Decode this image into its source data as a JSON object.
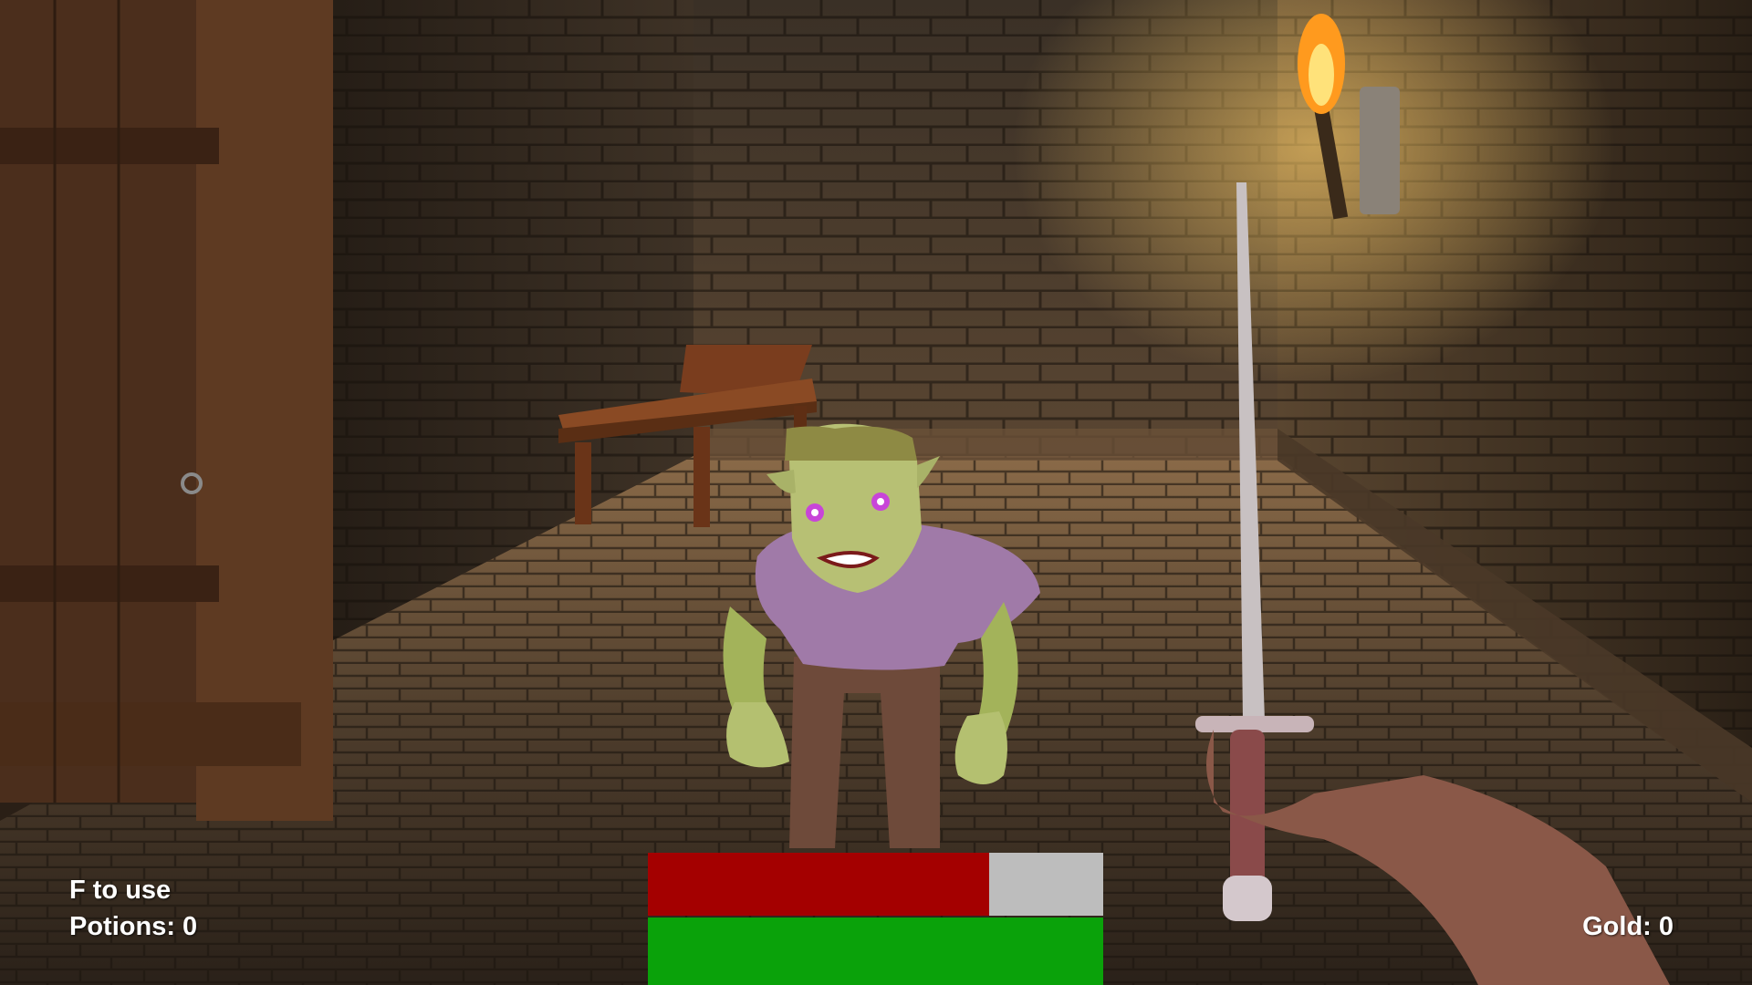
{
  "hud": {
    "hint": "F to use",
    "potions_label": "Potions: 0",
    "gold_label": "Gold: 0"
  },
  "bars": {
    "health": {
      "fraction": 0.75,
      "fill_color": "#a40000",
      "empty_color": "#bdbdbd"
    },
    "stamina": {
      "fraction": 1.0,
      "fill_color": "#0aa20a",
      "empty_color": "#bdbdbd"
    }
  },
  "scene": {
    "setting": "dungeon-room",
    "enemy": "goblin",
    "player_weapon": "sword",
    "light_source": "wall-torch"
  }
}
